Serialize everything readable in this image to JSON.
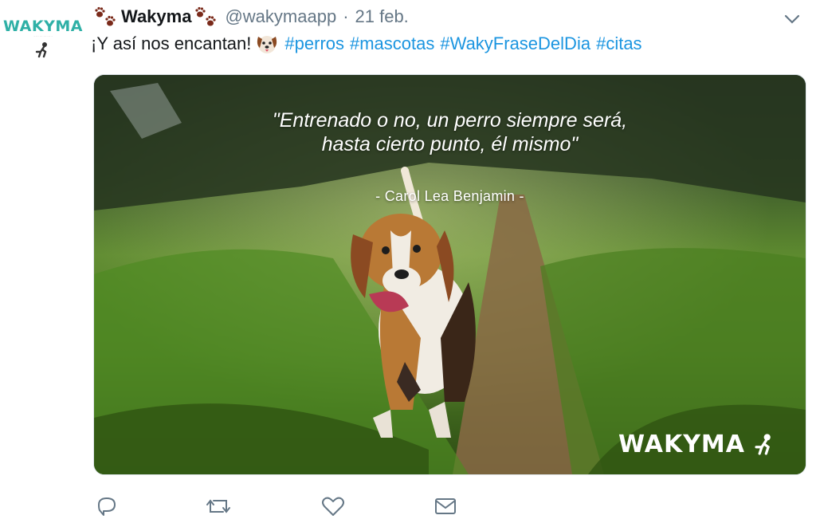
{
  "tweet": {
    "avatar_logo_text": "WAKYMA",
    "author_name": "Wakyma",
    "handle": "@wakymaapp",
    "separator": "·",
    "date": "21 feb.",
    "text": "¡Y así nos encantan!",
    "hashtags": [
      "#perros",
      "#mascotas",
      "#WakyFraseDelDia",
      "#citas"
    ],
    "icons": {
      "name_prefix": "paw-prints-icon",
      "name_suffix": "paw-prints-icon",
      "emoji": "dog-face-emoji-icon",
      "menu": "chevron-down-icon"
    }
  },
  "media": {
    "quote_line1": "\"Entrenado o no, un perro siempre será,",
    "quote_line2": "hasta cierto punto, él mismo\"",
    "author": "- Carol Lea Benjamin -",
    "watermark": "WAKYMA",
    "description_colors": {
      "grass": "#5d8a2f",
      "path": "#8a6a45",
      "dog_tan": "#b97935"
    }
  },
  "actions": [
    {
      "icon": "reply-icon"
    },
    {
      "icon": "retweet-icon"
    },
    {
      "icon": "like-icon"
    },
    {
      "icon": "direct-message-icon"
    }
  ],
  "colors": {
    "link": "#1b95e0",
    "muted": "#657786",
    "brand_teal": "#2fb0a6"
  }
}
